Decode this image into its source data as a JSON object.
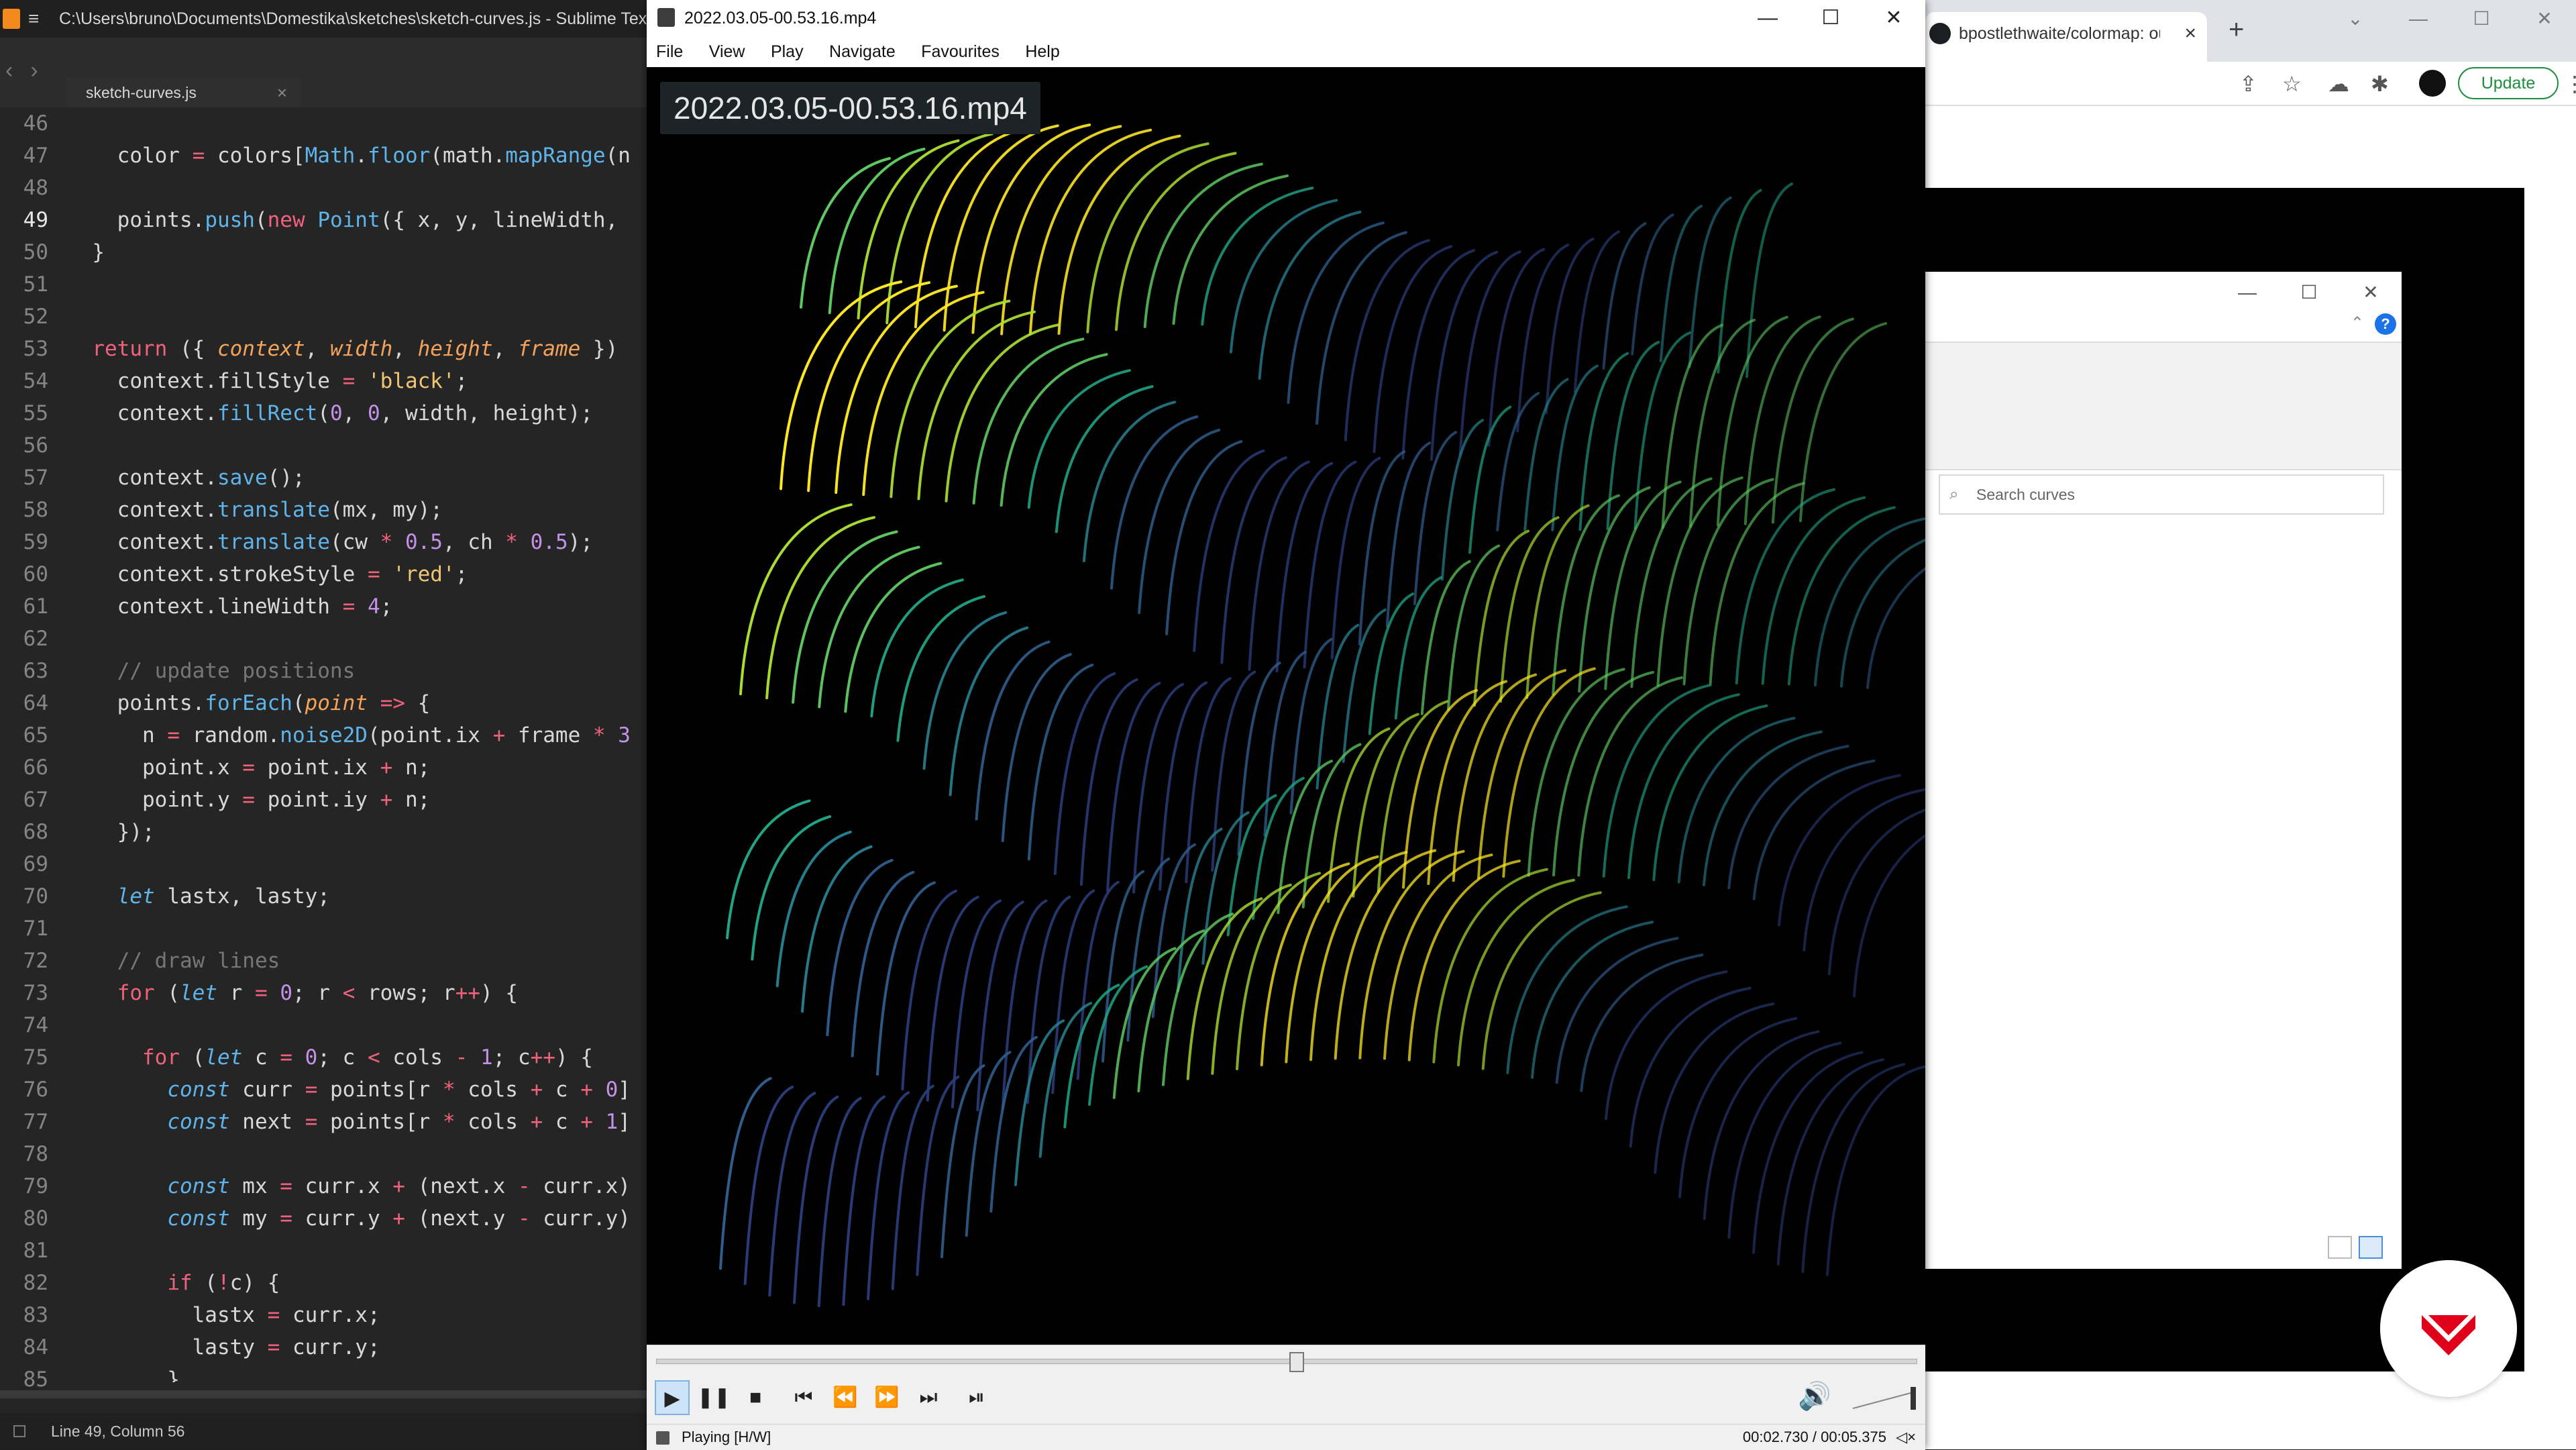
{
  "sublime": {
    "title": "C:\\Users\\bruno\\Documents\\Domestika\\sketches\\sketch-curves.js - Sublime Text",
    "tab": "sketch-curves.js",
    "status": "Line 49, Column 56",
    "current_line": 49,
    "line_numbers": [
      "46",
      "47",
      "48",
      "49",
      "50",
      "51",
      "52",
      "53",
      "54",
      "55",
      "56",
      "57",
      "58",
      "59",
      "60",
      "61",
      "62",
      "63",
      "64",
      "65",
      "66",
      "67",
      "68",
      "69",
      "70",
      "71",
      "72",
      "73",
      "74",
      "75",
      "76",
      "77",
      "78",
      "79",
      "80",
      "81",
      "82",
      "83",
      "84",
      "85"
    ]
  },
  "player": {
    "title": "2022.03.05-00.53.16.mp4",
    "menu": [
      "File",
      "View",
      "Play",
      "Navigate",
      "Favourites",
      "Help"
    ],
    "osd": "2022.03.05-00.53.16.mp4",
    "status": "Playing [H/W]",
    "time": "00:02.730 / 00:05.375",
    "progress_fraction": 0.508
  },
  "browser": {
    "tab_title": "bpostlethwaite/colormap: out",
    "update_label": "Update",
    "search_placeholder": "Search curves"
  },
  "icons": {
    "sublime": "sublime-logo-icon",
    "player": "film-icon",
    "github": "github-icon",
    "brand": "domestika-logo-icon"
  },
  "colors": {
    "editor_bg": "#252525",
    "keyword": "#f0627b",
    "function": "#5fb4ea",
    "string": "#f0c674",
    "number": "#c492e8",
    "comment": "#777777",
    "brand": "#e1001a",
    "update_green": "#1e8e3e"
  }
}
